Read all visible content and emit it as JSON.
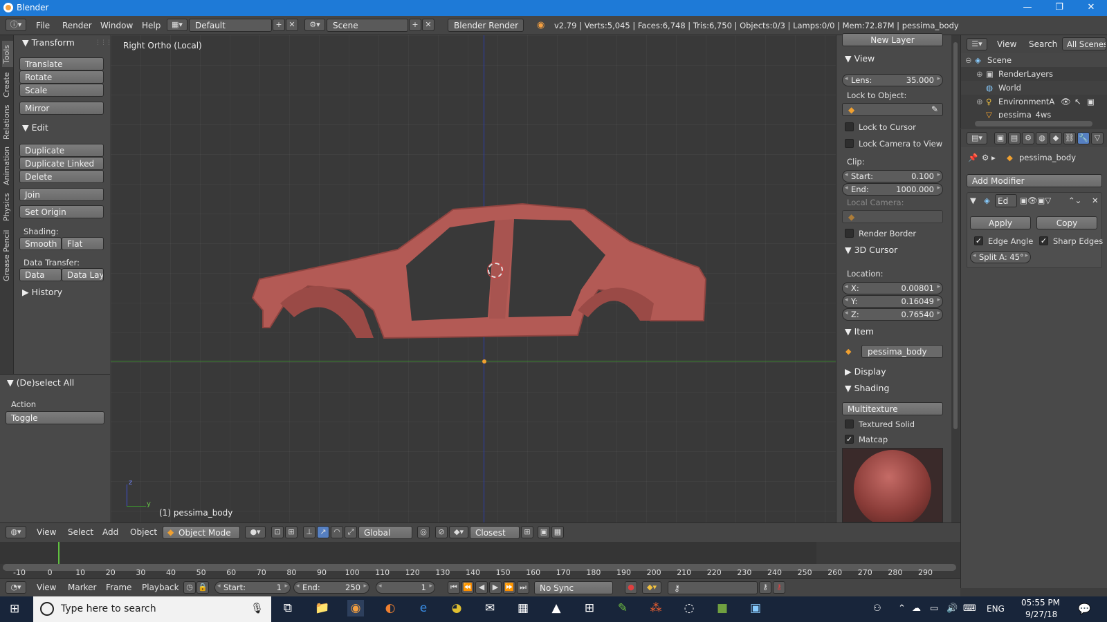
{
  "window": {
    "title": "Blender",
    "minimize": "—",
    "maximize": "❐",
    "close": "✕"
  },
  "info": {
    "menus": [
      "File",
      "Render",
      "Window",
      "Help"
    ],
    "layout": "Default",
    "scene": "Scene",
    "engine": "Blender Render",
    "stats": "v2.79 | Verts:5,045 | Faces:6,748 | Tris:6,750 | Objects:0/3 | Lamps:0/0 | Mem:72.87M | pessima_body"
  },
  "tabs": [
    "Tools",
    "Create",
    "Relations",
    "Animation",
    "Physics",
    "Grease Pencil"
  ],
  "tool": {
    "transform": {
      "header": "Transform",
      "buttons": [
        "Translate",
        "Rotate",
        "Scale"
      ],
      "mirror": "Mirror"
    },
    "edit": {
      "header": "Edit",
      "buttons": [
        "Duplicate",
        "Duplicate Linked",
        "Delete"
      ],
      "join": "Join",
      "set_origin": "Set Origin",
      "shading_label": "Shading:",
      "smooth": "Smooth",
      "flat": "Flat",
      "transfer_label": "Data Transfer:",
      "data": "Data",
      "data_layout": "Data Layo"
    },
    "history": "History"
  },
  "operator": {
    "header": "(De)select All",
    "action_label": "Action",
    "action_value": "Toggle"
  },
  "viewport": {
    "view_name": "Right Ortho (Local)",
    "object_name": "(1) pessima_body",
    "axis_z": "z",
    "axis_y": "y"
  },
  "props": {
    "new_layer": "New Layer",
    "view": {
      "header": "View",
      "lens_label": "Lens:",
      "lens": "35.000",
      "lock_obj": "Lock to Object:",
      "lock_cursor": "Lock to Cursor",
      "lock_camera": "Lock Camera to View",
      "clip": "Clip:",
      "start_label": "Start:",
      "start": "0.100",
      "end_label": "End:",
      "end": "1000.000",
      "local_cam": "Local Camera:",
      "render_border": "Render Border"
    },
    "cursor": {
      "header": "3D Cursor",
      "location": "Location:",
      "x_label": "X:",
      "x": "0.00801",
      "y_label": "Y:",
      "y": "0.16049",
      "z_label": "Z:",
      "z": "0.76540"
    },
    "item": {
      "header": "Item",
      "name": "pessima_body"
    },
    "display": {
      "header": "Display"
    },
    "shading": {
      "header": "Shading",
      "mode": "Multitexture",
      "textured_solid": "Textured Solid",
      "matcap": "Matcap"
    }
  },
  "outliner": {
    "view": "View",
    "search": "Search",
    "all_scenes": "All Scenes",
    "items": [
      "Scene",
      "RenderLayers",
      "World",
      "EnvironmentA",
      "pessima_4ws"
    ]
  },
  "modifiers": {
    "object": "pessima_body",
    "add": "Add Modifier",
    "mod_name": "Ed",
    "apply": "Apply",
    "copy": "Copy",
    "edge_angle": "Edge Angle",
    "sharp_edges": "Sharp Edges",
    "split": "Split A: 45°"
  },
  "header3d": {
    "menus": [
      "View",
      "Select",
      "Add",
      "Object"
    ],
    "mode": "Object Mode",
    "orientation": "Global",
    "snap": "Closest"
  },
  "timeline": {
    "ticks": [
      "-10",
      "0",
      "10",
      "20",
      "30",
      "40",
      "50",
      "60",
      "70",
      "80",
      "90",
      "100",
      "110",
      "120",
      "130",
      "140",
      "150",
      "160",
      "170",
      "180",
      "190",
      "200",
      "210",
      "220",
      "230",
      "240",
      "250",
      "260",
      "270",
      "280",
      "290"
    ],
    "menus": [
      "View",
      "Marker",
      "Frame",
      "Playback"
    ],
    "start_label": "Start:",
    "start": "1",
    "end_label": "End:",
    "end": "250",
    "current": "1",
    "sync": "No Sync"
  },
  "taskbar": {
    "search": "Type here to search",
    "lang": "ENG",
    "time": "05:55 PM",
    "date": "9/27/18"
  },
  "colors": {
    "accent": "#5680c2",
    "car": "#b35a55",
    "titlebar": "#1e7ad7"
  }
}
